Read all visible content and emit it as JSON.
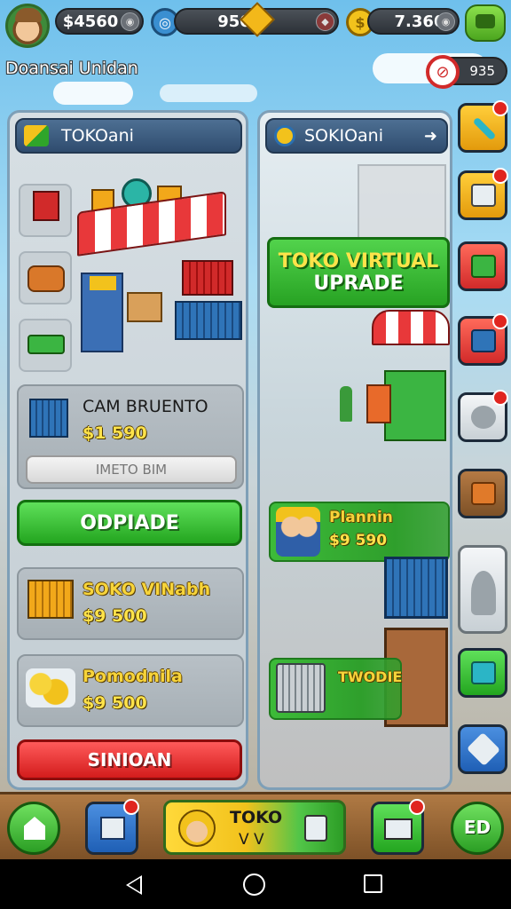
{
  "top_bar": {
    "money": "$4560",
    "gems": "950",
    "coins": "7.360"
  },
  "location_label": "Doansai Unidan",
  "notification_count": "935",
  "left_panel": {
    "title": "TOKOani",
    "feature_card": {
      "title": "CAM BRUENTO",
      "price": "$1 590",
      "button_label": "IMETO BIM"
    },
    "upgrade_button": "ODPIADE",
    "items": [
      {
        "name": "SOKO VINabh",
        "price": "$9 500"
      },
      {
        "name": "Pomodnila",
        "price": "$9 500"
      }
    ],
    "sell_button": "SINIOAN"
  },
  "right_panel": {
    "title": "SOKIOani",
    "banner_line1": "TOKO VIRTUAL",
    "banner_line2": "UPRADE",
    "staff_card": {
      "name": "Plannin",
      "price": "$9 590"
    },
    "cart_card": {
      "name": "TWODIE"
    }
  },
  "bottom_bar": {
    "center_title": "TOKO",
    "center_sub": "V V",
    "right_label": "ED"
  },
  "side_icons": [
    "tools-icon",
    "package-icon",
    "cash-register-icon",
    "atm-icon",
    "cleaning-icon",
    "box-icon",
    "hanger-icon",
    "book-icon",
    "tag-icon"
  ],
  "colors": {
    "primary_green": "#2fa52a",
    "danger_red": "#d31c1c",
    "panel_header_blue": "#2f4c6e",
    "price_yellow": "#ffe34a"
  }
}
